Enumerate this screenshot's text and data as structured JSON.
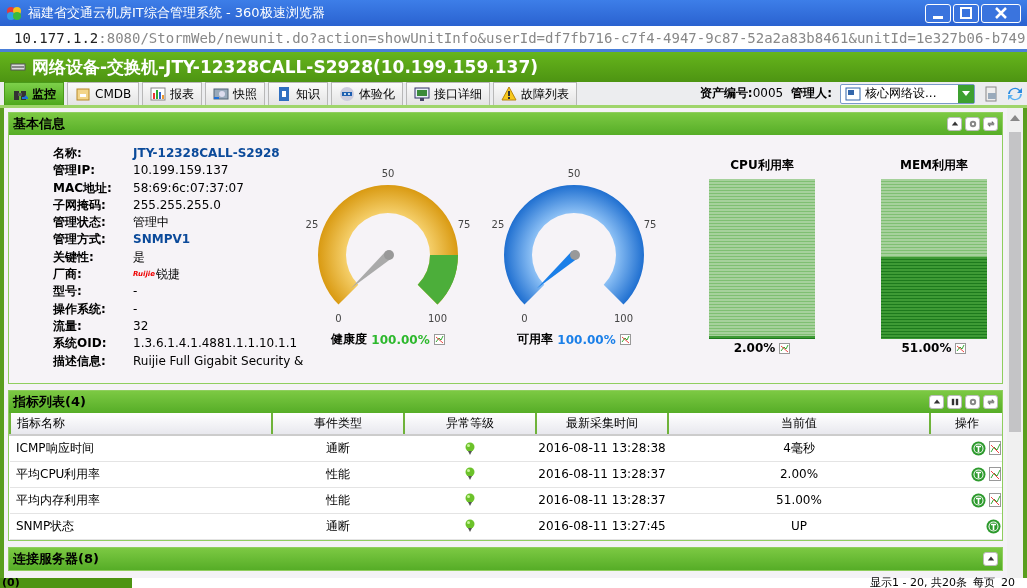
{
  "window": {
    "title": "福建省交通云机房IT综合管理系统 - 360极速浏览器"
  },
  "address": {
    "host": "10.177.1.2",
    "rest": ":8080/StormWeb/newunit.do?action=showUnitInfo&userId=df7fb716-c7f4-4947-9c87-52a2a83b8461&unitId=1e327b06-b749"
  },
  "page_title": "网络设备-交换机-JTY-12328CALL-S2928(10.199.159.137)",
  "tabs": [
    {
      "label": "监控",
      "selected": true
    },
    {
      "label": "CMDB",
      "selected": false
    },
    {
      "label": "报表",
      "selected": false
    },
    {
      "label": "快照",
      "selected": false
    },
    {
      "label": "知识",
      "selected": false
    },
    {
      "label": "体验化",
      "selected": false
    },
    {
      "label": "接口详细",
      "selected": false
    },
    {
      "label": "故障列表",
      "selected": false
    }
  ],
  "asset": {
    "label": "资产编号:",
    "value": "0005"
  },
  "manager": {
    "label": "管理人:",
    "value": "核心网络设..."
  },
  "basic_info": {
    "title": "基本信息",
    "fields": [
      {
        "label": "名称:",
        "value": "JTY-12328CALL-S2928",
        "kind": "link"
      },
      {
        "label": "管理IP:",
        "value": "10.199.159.137",
        "kind": "text"
      },
      {
        "label": "MAC地址:",
        "value": "58:69:6c:07:37:07",
        "kind": "text"
      },
      {
        "label": "子网掩码:",
        "value": "255.255.255.0",
        "kind": "text"
      },
      {
        "label": "管理状态:",
        "value": "管理中",
        "kind": "text"
      },
      {
        "label": "管理方式:",
        "value": "SNMPV1",
        "kind": "link"
      },
      {
        "label": "关键性:",
        "value": "是",
        "kind": "text"
      },
      {
        "label": "厂商:",
        "value": "锐捷",
        "logo": "Ruijie",
        "kind": "vendor"
      },
      {
        "label": "型号:",
        "value": "-",
        "kind": "text"
      },
      {
        "label": "操作系统:",
        "value": "-",
        "kind": "text"
      },
      {
        "label": "流量:",
        "value": "32",
        "kind": "text"
      },
      {
        "label": "系统OID:",
        "value": "1.3.6.1.4.1.4881.1.1.10.1.1",
        "kind": "text"
      },
      {
        "label": "描述信息:",
        "value": "Ruijie Full Gigabit Security &",
        "kind": "text"
      }
    ],
    "gauges": [
      {
        "label": "健康度",
        "value": "100.00%",
        "color": "#2db82d",
        "ticks": [
          "0",
          "25",
          "50",
          "75",
          "100"
        ]
      },
      {
        "label": "可用率",
        "value": "100.00%",
        "color": "#1a7fe8",
        "ticks": [
          "0",
          "25",
          "50",
          "75",
          "100"
        ]
      }
    ],
    "meters": [
      {
        "title": "CPU利用率",
        "level": 0.02,
        "reading": "2.00%"
      },
      {
        "title": "MEM利用率",
        "level": 0.51,
        "reading": "51.00%"
      }
    ]
  },
  "metrics": {
    "title": "指标列表(4)",
    "columns": [
      "指标名称",
      "事件类型",
      "异常等级",
      "最新采集时间",
      "当前值",
      "操作"
    ],
    "rows": [
      {
        "name": "ICMP响应时间",
        "type": "通断",
        "time": "2016-08-11 13:28:38",
        "value": "4毫秒",
        "has_chart": true
      },
      {
        "name": "平均CPU利用率",
        "type": "性能",
        "time": "2016-08-11 13:28:37",
        "value": "2.00%",
        "has_chart": true
      },
      {
        "name": "平均内存利用率",
        "type": "性能",
        "time": "2016-08-11 13:28:37",
        "value": "51.00%",
        "has_chart": true
      },
      {
        "name": "SNMP状态",
        "type": "通断",
        "time": "2016-08-11 13:27:45",
        "value": "UP",
        "has_chart": false
      }
    ]
  },
  "servers": {
    "title": "连接服务器(8)"
  },
  "footer": {
    "left": "(0)",
    "paging": "显示1 - 20, 共20条",
    "per_page_label": "每页",
    "per_page": "20"
  }
}
